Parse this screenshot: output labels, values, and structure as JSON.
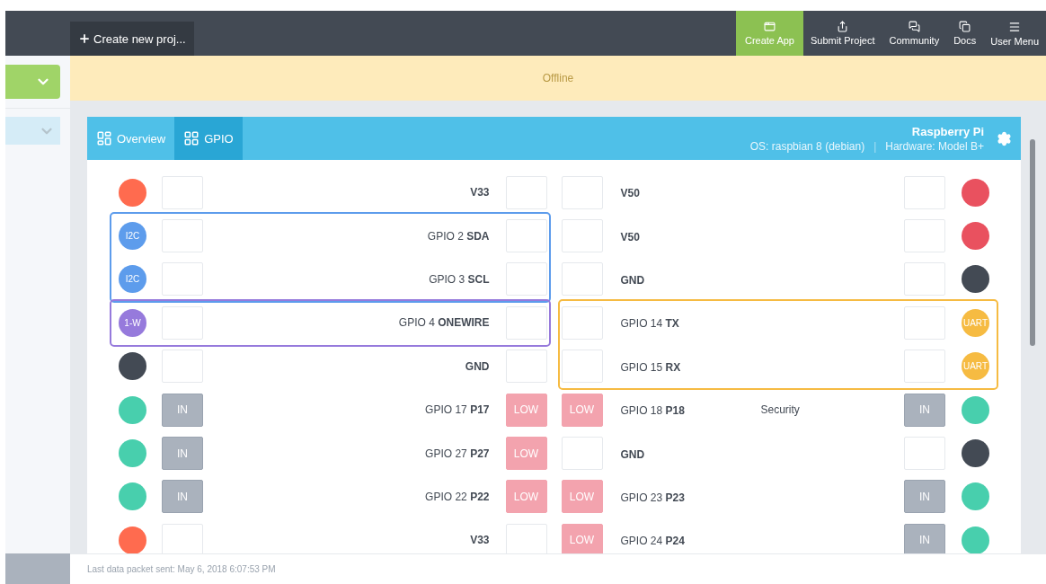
{
  "topbar": {
    "create_button": "Create new proj...",
    "nav": [
      {
        "label": "Create App",
        "selected": true
      },
      {
        "label": "Submit Project",
        "selected": false
      },
      {
        "label": "Community",
        "selected": false
      },
      {
        "label": "Docs",
        "selected": false
      },
      {
        "label": "User Menu",
        "selected": false
      }
    ]
  },
  "banner": "Offline",
  "card": {
    "tabs": [
      {
        "label": "Overview",
        "selected": false
      },
      {
        "label": "GPIO",
        "selected": true
      }
    ],
    "device": {
      "name": "Raspberry Pi",
      "os": "OS: raspbian 8 (debian)",
      "separator": "|",
      "hardware": "Hardware: Model B+"
    },
    "left": [
      {
        "pins": [
          {
            "name": "V33",
            "kind": "power",
            "color": "#ff6b4f"
          }
        ]
      },
      {
        "color": "#5d9cec",
        "pins": [
          {
            "name": "GPIO 2 **SDA**",
            "kind": "gpio",
            "color": "#5d9cec",
            "badge": "I2C"
          },
          {
            "name": "GPIO 3 **SCL**",
            "kind": "gpio",
            "color": "#5d9cec",
            "badge": "I2C"
          }
        ]
      },
      {
        "color": "#967adc",
        "pins": [
          {
            "name": "GPIO 4 **ONEWIRE**",
            "kind": "gpio",
            "color": "#967adc",
            "badge": "1-W"
          }
        ]
      },
      {
        "pins": [
          {
            "name": "GND",
            "kind": "power",
            "color": "#434a54"
          }
        ]
      },
      {
        "pins": [
          {
            "name": "GPIO 17 **P17**",
            "kind": "gpio",
            "color": "#48cfad",
            "mode": "IN",
            "value": "LOW"
          }
        ]
      },
      {
        "pins": [
          {
            "name": "GPIO 27 **P27**",
            "kind": "gpio",
            "color": "#48cfad",
            "mode": "IN",
            "value": "LOW"
          }
        ]
      },
      {
        "pins": [
          {
            "name": "GPIO 22 **P22**",
            "kind": "gpio",
            "color": "#48cfad",
            "mode": "IN",
            "value": "LOW"
          }
        ]
      },
      {
        "pins": [
          {
            "name": "V33",
            "kind": "power",
            "color": "#ff6b4f"
          }
        ]
      }
    ],
    "right": [
      {
        "pins": [
          {
            "name": "V50",
            "kind": "power",
            "color": "#e9515f"
          }
        ]
      },
      {
        "pins": [
          {
            "name": "V50",
            "kind": "power",
            "color": "#e9515f"
          }
        ]
      },
      {
        "pins": [
          {
            "name": "GND",
            "kind": "power",
            "color": "#434a54"
          }
        ]
      },
      {
        "color": "#f6bb42",
        "pins": [
          {
            "name": "GPIO 14 **TX**",
            "kind": "gpio",
            "color": "#f6bb42",
            "badge": "UART"
          },
          {
            "name": "GPIO 15 **RX**",
            "kind": "gpio",
            "color": "#f6bb42",
            "badge": "UART"
          }
        ]
      },
      {
        "pins": [
          {
            "name": "GPIO 18 **P18**",
            "kind": "gpio",
            "color": "#48cfad",
            "mode": "IN",
            "value": "LOW",
            "note": "Security"
          }
        ]
      },
      {
        "pins": [
          {
            "name": "GND",
            "kind": "power",
            "color": "#434a54"
          }
        ]
      },
      {
        "pins": [
          {
            "name": "GPIO 23 **P23**",
            "kind": "gpio",
            "color": "#48cfad",
            "mode": "IN",
            "value": "LOW"
          }
        ]
      },
      {
        "pins": [
          {
            "name": "GPIO 24 **P24**",
            "kind": "gpio",
            "color": "#48cfad",
            "mode": "IN",
            "value": "LOW"
          }
        ]
      }
    ]
  },
  "footer": "Last data packet sent: May 6, 2018 6:07:53 PM"
}
